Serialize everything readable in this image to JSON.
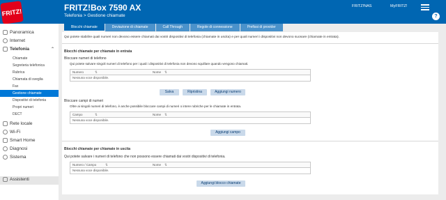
{
  "header": {
    "product": "FRITZ!Box 7590 AX",
    "links": [
      "FRITZ!NAS",
      "MyFRITZ!"
    ],
    "breadcrumb": "Telefonia > Gestione chiamate",
    "logo_text": "FRITZ!"
  },
  "tabs": [
    {
      "label": "Blocchi chiamate",
      "active": true
    },
    {
      "label": "Deviazione di chiamate",
      "active": false
    },
    {
      "label": "Call Through",
      "active": false
    },
    {
      "label": "Regole di connessione",
      "active": false
    },
    {
      "label": "Prefissi di provider",
      "active": false
    }
  ],
  "sidebar": {
    "top": [
      {
        "label": "Panoramica",
        "icon": "home-icon"
      },
      {
        "label": "Internet",
        "icon": "globe-icon"
      },
      {
        "label": "Telefonia",
        "icon": "phone-icon",
        "expanded": true
      }
    ],
    "sub": [
      "Chiamate",
      "Segreteria telefonica",
      "Rubrica",
      "Chiamata di sveglia",
      "Fax",
      "Gestione chiamate",
      "Dispositivi di telefonia",
      "Propri numeri",
      "DECT"
    ],
    "active_sub": "Gestione chiamate",
    "bottom": [
      {
        "label": "Rete locale",
        "icon": "network-icon"
      },
      {
        "label": "Wi-Fi",
        "icon": "wifi-icon"
      },
      {
        "label": "Smart Home",
        "icon": "smart-home-icon"
      },
      {
        "label": "Diagnosi",
        "icon": "diagnosis-icon"
      },
      {
        "label": "Sistema",
        "icon": "system-icon"
      },
      {
        "label": "Assistenti",
        "icon": "wizard-icon"
      }
    ]
  },
  "main": {
    "intro": "Qui potete stabilire quali numeri non devono essere chiamati dai vostri dispositivi di telefonia (chiamate in uscita) e per quali numeri i dispositivi non devono suonare (chiamate in entrata).",
    "incoming": {
      "title": "Blocchi chiamate per chiamate in entrata",
      "phone_block": {
        "subtitle": "Bloccare numeri di telefono",
        "desc": "Qui potete salvare singoli numeri di telefono per i quali i dispositivi di telefonia non devono squillare quando vengono chiamati.",
        "col1": "Numero",
        "col2": "Nome",
        "empty": "Nessuna voce disponibile.",
        "buttons": [
          "Salva",
          "Ripristina",
          "Aggiungi numero"
        ]
      },
      "field_block": {
        "subtitle": "Bloccare campi di numeri",
        "desc": "Oltre ai singoli numeri di telefono, è anche possibile bloccare campi di numeri o intere rubriche per le chiamate in entrata.",
        "col1": "Campo",
        "col2": "Nome",
        "empty": "Nessuna voce disponibile.",
        "button": "Aggiungi campo"
      }
    },
    "outgoing": {
      "title": "Blocchi chiamate per chiamate in uscita",
      "desc": "Qui potete salvare i numeri di telefono che non possono essere chiamati dai vostri dispositivi di telefonia.",
      "col1": "Numero / Campo",
      "col2": "Nome",
      "empty": "Nessuna voce disponibile.",
      "button": "Aggiungi blocco chiamate"
    }
  }
}
